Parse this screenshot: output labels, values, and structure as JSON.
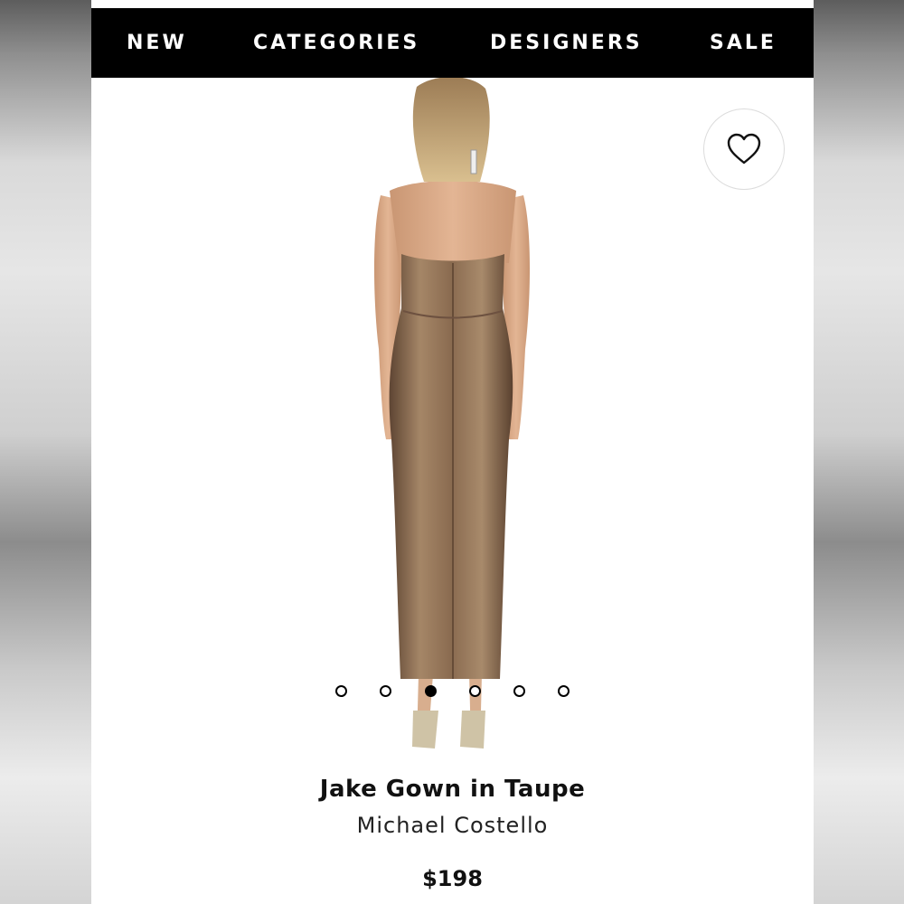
{
  "nav": {
    "items": [
      {
        "label": "NEW"
      },
      {
        "label": "CATEGORIES"
      },
      {
        "label": "DESIGNERS"
      },
      {
        "label": "SALE"
      }
    ]
  },
  "product": {
    "name": "Jake Gown in Taupe",
    "designer": "Michael Costello",
    "price": "$198",
    "image_icon": "product-photo",
    "favorite_icon": "heart-icon"
  },
  "carousel": {
    "total": 6,
    "active_index": 2
  },
  "colors": {
    "nav_bg": "#000000",
    "nav_text": "#ffffff",
    "gown": "#8a6a4f",
    "background": "#ffffff"
  }
}
